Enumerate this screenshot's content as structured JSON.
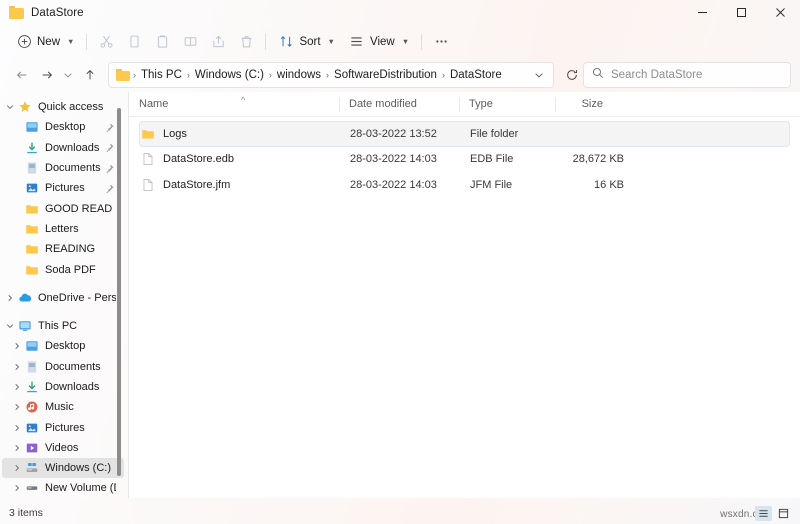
{
  "window": {
    "title": "DataStore",
    "minimize_label": "Minimize",
    "maximize_label": "Maximize",
    "close_label": "Close"
  },
  "toolbar": {
    "new_label": "New",
    "cut_label": "Cut",
    "copy_label": "Copy",
    "paste_label": "Paste",
    "rename_label": "Rename",
    "share_label": "Share",
    "delete_label": "Delete",
    "sort_label": "Sort",
    "view_label": "View",
    "more_label": "See more"
  },
  "navigation": {
    "back_label": "Back",
    "forward_label": "Forward",
    "recent_label": "Recent locations",
    "up_label": "Up to SoftwareDistribution",
    "refresh_label": "Refresh",
    "breadcrumbs": [
      "This PC",
      "Windows (C:)",
      "windows",
      "SoftwareDistribution",
      "DataStore"
    ],
    "separator": "›"
  },
  "search": {
    "placeholder": "Search DataStore",
    "icon": "search-icon"
  },
  "sidebar": {
    "quick_access": {
      "label": "Quick access",
      "icon": "star-icon",
      "expanded": true,
      "items": [
        {
          "label": "Desktop",
          "icon": "desktop-icon",
          "pinned": true
        },
        {
          "label": "Downloads",
          "icon": "downloads-icon",
          "pinned": true
        },
        {
          "label": "Documents",
          "icon": "documents-icon",
          "pinned": true
        },
        {
          "label": "Pictures",
          "icon": "pictures-icon",
          "pinned": true
        },
        {
          "label": "GOOD READ",
          "icon": "folder-icon",
          "pinned": false
        },
        {
          "label": "Letters",
          "icon": "folder-icon",
          "pinned": false
        },
        {
          "label": "READING",
          "icon": "folder-icon",
          "pinned": false
        },
        {
          "label": "Soda PDF",
          "icon": "folder-icon",
          "pinned": false
        }
      ]
    },
    "onedrive": {
      "label": "OneDrive - Persona",
      "icon": "cloud-icon",
      "expanded": false
    },
    "this_pc": {
      "label": "This PC",
      "icon": "monitor-icon",
      "expanded": true,
      "items": [
        {
          "label": "Desktop",
          "icon": "desktop-icon",
          "selected": false
        },
        {
          "label": "Documents",
          "icon": "documents-icon",
          "selected": false
        },
        {
          "label": "Downloads",
          "icon": "downloads-icon",
          "selected": false
        },
        {
          "label": "Music",
          "icon": "music-icon",
          "selected": false
        },
        {
          "label": "Pictures",
          "icon": "pictures-icon",
          "selected": false
        },
        {
          "label": "Videos",
          "icon": "videos-icon",
          "selected": false
        },
        {
          "label": "Windows (C:)",
          "icon": "drive-windows-icon",
          "selected": true
        },
        {
          "label": "New Volume (D:)",
          "icon": "drive-icon",
          "selected": false
        }
      ]
    }
  },
  "filelist": {
    "columns": [
      {
        "key": "name",
        "label": "Name",
        "sorted": "asc"
      },
      {
        "key": "date",
        "label": "Date modified"
      },
      {
        "key": "type",
        "label": "Type"
      },
      {
        "key": "size",
        "label": "Size"
      }
    ],
    "sort_caret": "^",
    "rows": [
      {
        "name": "Logs",
        "date": "28-03-2022 13:52",
        "type": "File folder",
        "size": "",
        "icon": "folder-icon",
        "selected": true
      },
      {
        "name": "DataStore.edb",
        "date": "28-03-2022 14:03",
        "type": "EDB File",
        "size": "28,672 KB",
        "icon": "file-icon",
        "selected": false
      },
      {
        "name": "DataStore.jfm",
        "date": "28-03-2022 14:03",
        "type": "JFM File",
        "size": "16 KB",
        "icon": "file-icon",
        "selected": false
      }
    ]
  },
  "statusbar": {
    "item_count": "3 items",
    "details_view_label": "Details view",
    "large_icons_view_label": "Large icons view"
  },
  "watermark": {
    "text": "wsxdn.com"
  },
  "colors": {
    "folder": "#fcc94d",
    "accent": "#0078d4",
    "selection": "#f4f4f4",
    "selection_border": "#dfe7ef",
    "sidebar_selected": "#e3e3e3"
  }
}
